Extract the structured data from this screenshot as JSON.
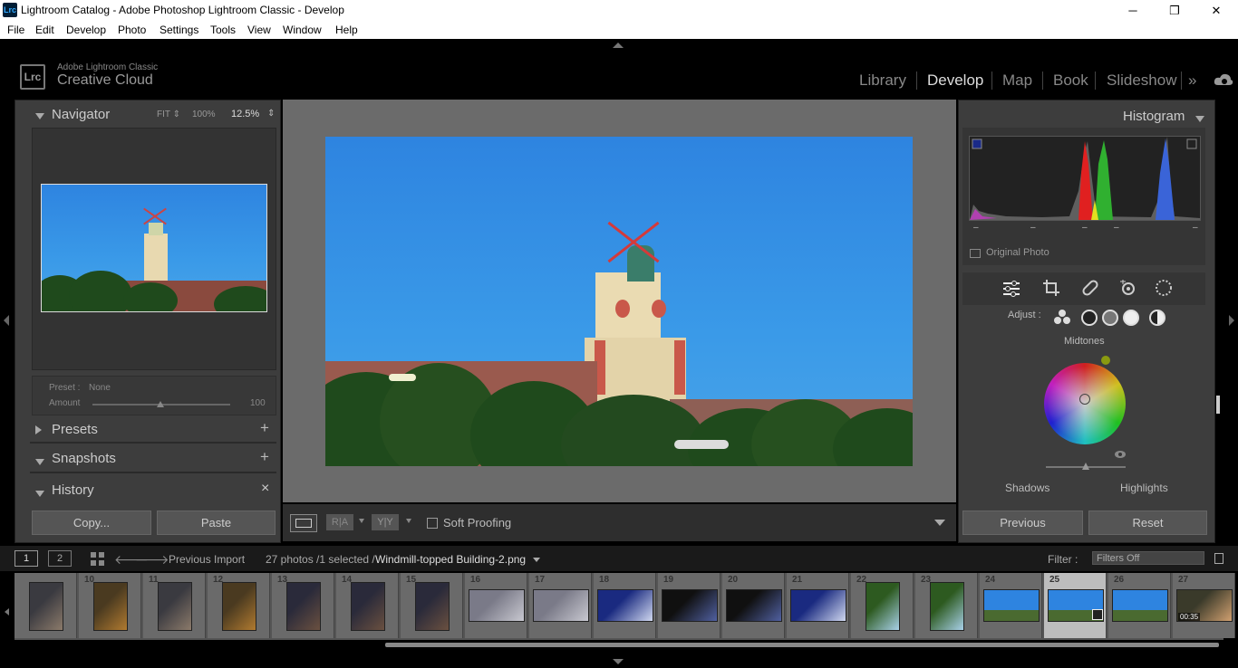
{
  "window": {
    "app_icon": "Lrc",
    "title": "Lightroom Catalog - Adobe Photoshop Lightroom Classic - Develop",
    "minimize_icon": "─",
    "restore_icon": "❐",
    "close_icon": "✕"
  },
  "menu": [
    "File",
    "Edit",
    "Develop",
    "Photo",
    "Settings",
    "Tools",
    "View",
    "Window",
    "Help"
  ],
  "identity": {
    "logo": "Lrc",
    "line1": "Adobe Lightroom Classic",
    "line2": "Creative Cloud"
  },
  "modules": [
    "Library",
    "Develop",
    "Map",
    "Book",
    "Slideshow"
  ],
  "active_module": "Develop",
  "modules_more_icon": "»",
  "navigator": {
    "title": "Navigator",
    "zoom_fit": "FIT ⇕",
    "zoom_100": "100%",
    "zoom_current": "12.5%",
    "zoom_arrow": "⇕"
  },
  "preset_box": {
    "preset_label": "Preset :",
    "preset_value": "None",
    "amount_label": "Amount",
    "amount_value": "100"
  },
  "left_sections": {
    "presets": "Presets",
    "presets_add": "+",
    "snapshots": "Snapshots",
    "snapshots_add": "+",
    "history": "History",
    "history_clear": "×"
  },
  "left_buttons": {
    "copy": "Copy...",
    "paste": "Paste"
  },
  "toolbar": {
    "ra": "R|A",
    "yy": "Y|Y",
    "soft_proofing": "Soft Proofing"
  },
  "right": {
    "histogram_title": "Histogram",
    "original_photo": "Original Photo",
    "hist_marks": [
      "–",
      "–",
      "–",
      "–",
      "–"
    ],
    "adjust_label": "Adjust :",
    "midtones": "Midtones",
    "shadows": "Shadows",
    "highlights": "Highlights"
  },
  "right_buttons": {
    "previous": "Previous",
    "reset": "Reset"
  },
  "filmbar": {
    "view1": "1",
    "view2": "2",
    "source": "Previous Import",
    "count": "27 photos /1 selected /",
    "filename": "Windmill-topped Building-2.png",
    "filter_label": "Filter :",
    "filter_value": "Filters Off"
  },
  "filmstrip": [
    {
      "num": "",
      "kind": "people"
    },
    {
      "num": "10",
      "kind": "cafe"
    },
    {
      "num": "11",
      "kind": "people"
    },
    {
      "num": "12",
      "kind": "cafe"
    },
    {
      "num": "13",
      "kind": "person"
    },
    {
      "num": "14",
      "kind": "person"
    },
    {
      "num": "15",
      "kind": "person"
    },
    {
      "num": "16",
      "kind": "fan"
    },
    {
      "num": "17",
      "kind": "fan"
    },
    {
      "num": "18",
      "kind": "screen"
    },
    {
      "num": "19",
      "kind": "tv"
    },
    {
      "num": "20",
      "kind": "tv"
    },
    {
      "num": "21",
      "kind": "screen"
    },
    {
      "num": "22",
      "kind": "plant"
    },
    {
      "num": "23",
      "kind": "plant"
    },
    {
      "num": "24",
      "kind": "sky"
    },
    {
      "num": "25",
      "kind": "sky"
    },
    {
      "num": "26",
      "kind": "sky"
    },
    {
      "num": "27",
      "kind": "group"
    }
  ],
  "filmstrip_selected": "25",
  "video_duration": "00:35",
  "colors": {
    "accent_sky": "#2e84e0",
    "panel": "#3d3d3d",
    "center_bg": "#6b6b6b"
  }
}
